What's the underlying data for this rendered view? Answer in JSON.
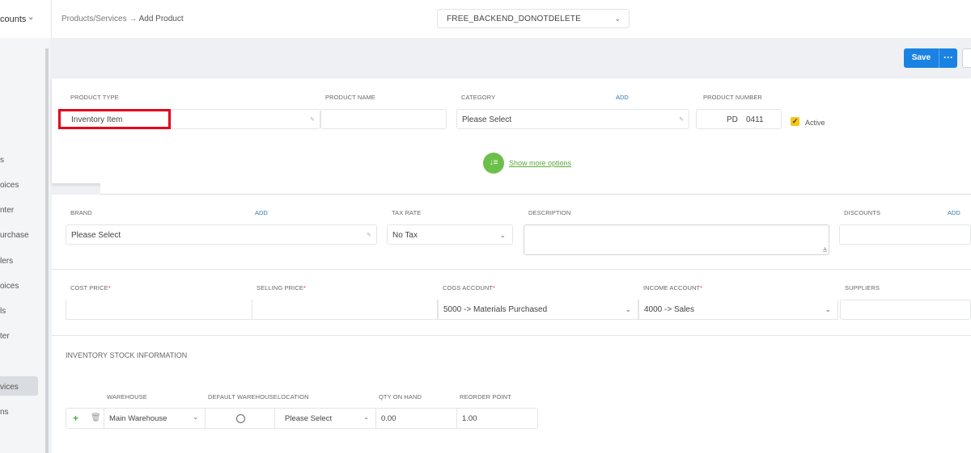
{
  "topbar": {
    "account_label": "counts",
    "breadcrumb_parent": "Products/Services",
    "breadcrumb_sep": " → ",
    "breadcrumb_current": "Add Product",
    "org_selector": "FREE_BACKEND_DONOTDELETE"
  },
  "sidebar": {
    "items": [
      "s",
      "oices",
      "nter",
      "urchase",
      "lers",
      "oices",
      "ls",
      "ter",
      "vices",
      "ns"
    ],
    "active_index": 8
  },
  "toolbar": {
    "save_label": "Save",
    "more_label": "···"
  },
  "product": {
    "type_label": "PRODUCT TYPE",
    "type_value": "Inventory Item",
    "name_label": "PRODUCT NAME",
    "name_value": "",
    "category_label": "CATEGORY",
    "category_add": "ADD",
    "category_value": "Please Select",
    "number_label": "PRODUCT NUMBER",
    "number_prefix": "PD",
    "number_value": "0411",
    "active_label": "Active",
    "active_checked": true,
    "show_more": "Show more options"
  },
  "details": {
    "brand_label": "BRAND",
    "brand_add": "ADD",
    "brand_value": "Please Select",
    "tax_label": "TAX RATE",
    "tax_value": "No Tax",
    "desc_label": "DESCRIPTION",
    "discounts_label": "DISCOUNTS",
    "discounts_add": "ADD"
  },
  "pricing": {
    "cost_label": "COST PRICE",
    "selling_label": "SELLING PRICE",
    "cogs_label": "COGS ACCOUNT",
    "cogs_value": "5000 -> Materials Purchased",
    "income_label": "INCOME ACCOUNT",
    "income_value": "4000 -> Sales",
    "suppliers_label": "SUPPLIERS",
    "required_mark": "*"
  },
  "inventory": {
    "title": "INVENTORY STOCK INFORMATION",
    "columns": [
      "WAREHOUSE",
      "DEFAULT WAREHOUSE",
      "LOCATION",
      "QTY ON HAND",
      "REORDER POINT"
    ],
    "rows": [
      {
        "warehouse": "Main Warehouse",
        "location": "Please Select",
        "qty": "0.00",
        "reorder": "1.00"
      }
    ]
  }
}
